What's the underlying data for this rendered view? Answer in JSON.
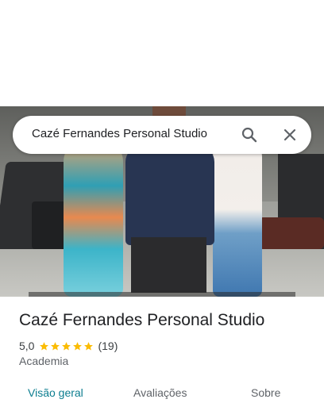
{
  "search": {
    "query": "Cazé Fernandes Personal Studio",
    "search_icon": "search-icon",
    "close_icon": "close-icon"
  },
  "photo": {
    "description_icon": "place-photo"
  },
  "place": {
    "name": "Cazé Fernandes Personal Studio",
    "rating": "5,0",
    "stars": 5,
    "review_count": "(19)",
    "category": "Academia"
  },
  "tabs": [
    {
      "label": "Visão geral",
      "active": true
    },
    {
      "label": "Avaliações",
      "active": false
    },
    {
      "label": "Sobre",
      "active": false
    }
  ],
  "colors": {
    "active_tab": "#0b7d8f",
    "star": "#fbbc04",
    "text": "#202124",
    "muted": "#5f6368"
  }
}
